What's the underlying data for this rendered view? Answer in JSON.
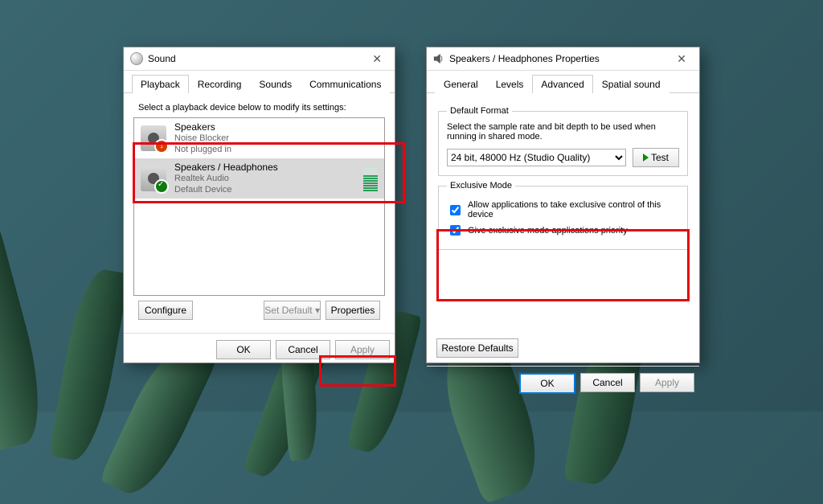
{
  "sound_window": {
    "title": "Sound",
    "tabs": [
      "Playback",
      "Recording",
      "Sounds",
      "Communications"
    ],
    "active_tab": 0,
    "instruction": "Select a playback device below to modify its settings:",
    "devices": [
      {
        "name": "Speakers",
        "subtitle": "Noise Blocker",
        "status": "Not plugged in",
        "state": "error"
      },
      {
        "name": "Speakers / Headphones",
        "subtitle": "Realtek Audio",
        "status": "Default Device",
        "state": "ok",
        "selected": true
      }
    ],
    "buttons": {
      "configure": "Configure",
      "set_default": "Set Default",
      "properties": "Properties",
      "ok": "OK",
      "cancel": "Cancel",
      "apply": "Apply"
    }
  },
  "props_window": {
    "title": "Speakers / Headphones Properties",
    "tabs": [
      "General",
      "Levels",
      "Advanced",
      "Spatial sound"
    ],
    "active_tab": 2,
    "default_format": {
      "legend": "Default Format",
      "desc": "Select the sample rate and bit depth to be used when running in shared mode.",
      "selected": "24 bit, 48000 Hz (Studio Quality)",
      "test": "Test"
    },
    "exclusive": {
      "legend": "Exclusive Mode",
      "opt1": "Allow applications to take exclusive control of this device",
      "opt2": "Give exclusive mode applications priority"
    },
    "restore": "Restore Defaults",
    "buttons": {
      "ok": "OK",
      "cancel": "Cancel",
      "apply": "Apply"
    }
  }
}
